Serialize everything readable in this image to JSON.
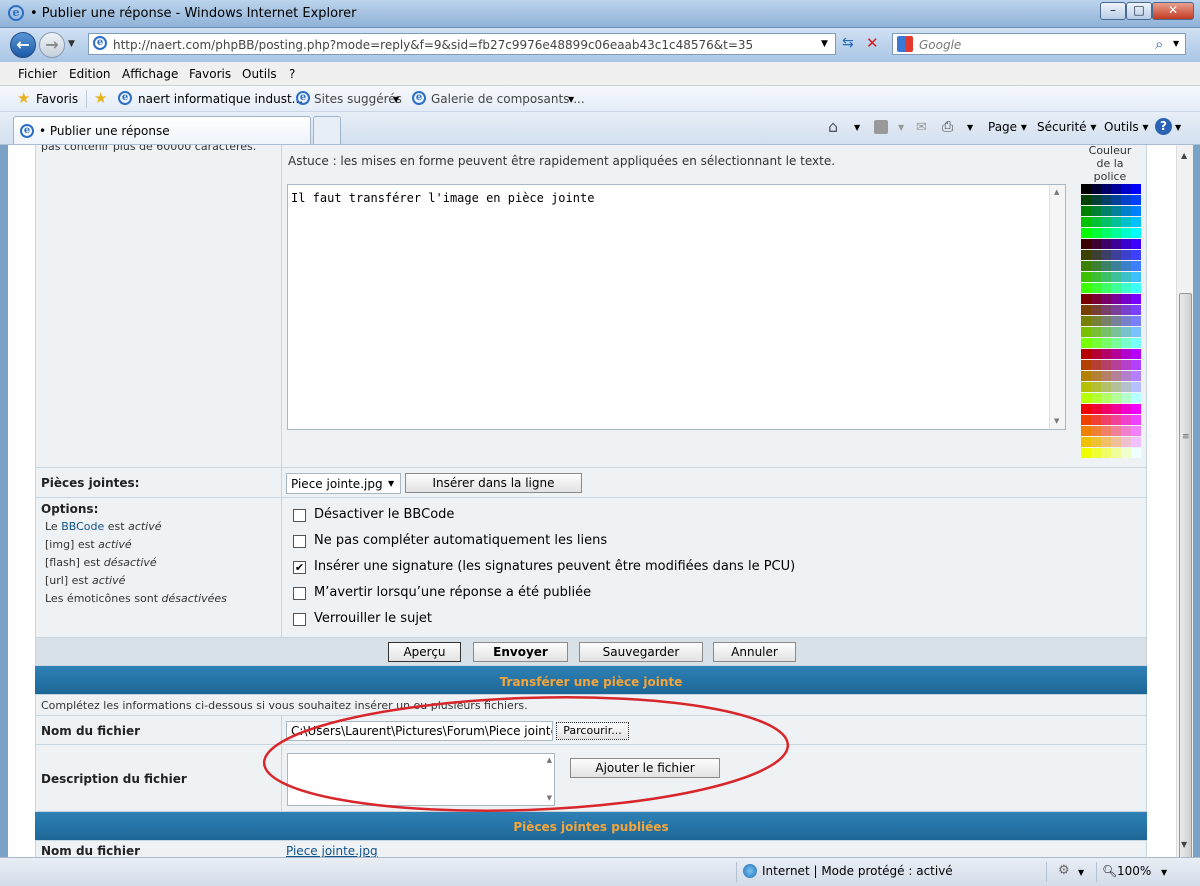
{
  "window": {
    "title": "• Publier une réponse - Windows Internet Explorer",
    "minimize": "–",
    "maximize": "□",
    "close": "✕"
  },
  "nav": {
    "url": "http://naert.com/phpBB/posting.php?mode=reply&f=9&sid=fb27c9976e48899c06eaab43c1c48576&t=35",
    "search_placeholder": "Google"
  },
  "menu": [
    "Fichier",
    "Edition",
    "Affichage",
    "Favoris",
    "Outils",
    "?"
  ],
  "favorites": {
    "favoris_label": "Favoris",
    "items": [
      "naert informatique indust...",
      "Sites suggérés",
      "Galerie de composants ..."
    ]
  },
  "tab": {
    "title": "• Publier une réponse"
  },
  "commandbar": {
    "page": "Page",
    "securite": "Sécurité",
    "outils": "Outils"
  },
  "content": {
    "top_fragment": "pas contenir plus de 60000 caractères.",
    "tip": "Astuce : les mises en forme peuvent être rapidement appliquées en sélectionnant le texte.",
    "textarea_value": "Il faut transférer l'image en pièce jointe",
    "color_label": [
      "Couleur",
      "de la",
      "police"
    ],
    "attachments_label": "Pièces jointes:",
    "attachment_select": "Piece jointe.jpg",
    "insert_inline": "Insérer dans la ligne",
    "options_label": "Options:",
    "options_info": [
      {
        "pre": "Le ",
        "link": "BBCode",
        "mid": " est ",
        "em": "activé"
      },
      {
        "pre": "[img] est ",
        "link": "",
        "mid": "",
        "em": "activé"
      },
      {
        "pre": "[flash] est ",
        "link": "",
        "mid": "",
        "em": "désactivé"
      },
      {
        "pre": "[url] est ",
        "link": "",
        "mid": "",
        "em": "activé"
      },
      {
        "pre": "Les émoticônes sont ",
        "link": "",
        "mid": "",
        "em": "désactivées"
      }
    ],
    "checkboxes": [
      {
        "label": "Désactiver le BBCode",
        "checked": false
      },
      {
        "label": "Ne pas compléter automatiquement les liens",
        "checked": false
      },
      {
        "label": "Insérer une signature (les signatures peuvent être modifiées dans le PCU)",
        "checked": true
      },
      {
        "label": "M’avertir lorsqu’une réponse a été publiée",
        "checked": false
      },
      {
        "label": "Verrouiller le sujet",
        "checked": false
      }
    ],
    "buttons": {
      "preview": "Aperçu",
      "submit": "Envoyer",
      "save": "Sauvegarder",
      "cancel": "Annuler"
    },
    "upload_header": "Transférer une pièce jointe",
    "upload_info": "Complétez les informations ci-dessous si vous souhaitez insérer un ou plusieurs fichiers.",
    "filename_label": "Nom du fichier",
    "filename_value": "C:\\Users\\Laurent\\Pictures\\Forum\\Piece jointe",
    "browse": "Parcourir...",
    "description_label": "Description du fichier",
    "add_file": "Ajouter le fichier",
    "published_header": "Pièces jointes publiées",
    "published_name_label": "Nom du fichier",
    "published_file": "Piece jointe.jpg"
  },
  "status": {
    "zone": "Internet | Mode protégé : activé",
    "zoom": "100%"
  },
  "colors": {
    "accent": "#1d6796",
    "header_text": "#f6a53a",
    "link": "#105289",
    "annotation": "#d8262a"
  }
}
